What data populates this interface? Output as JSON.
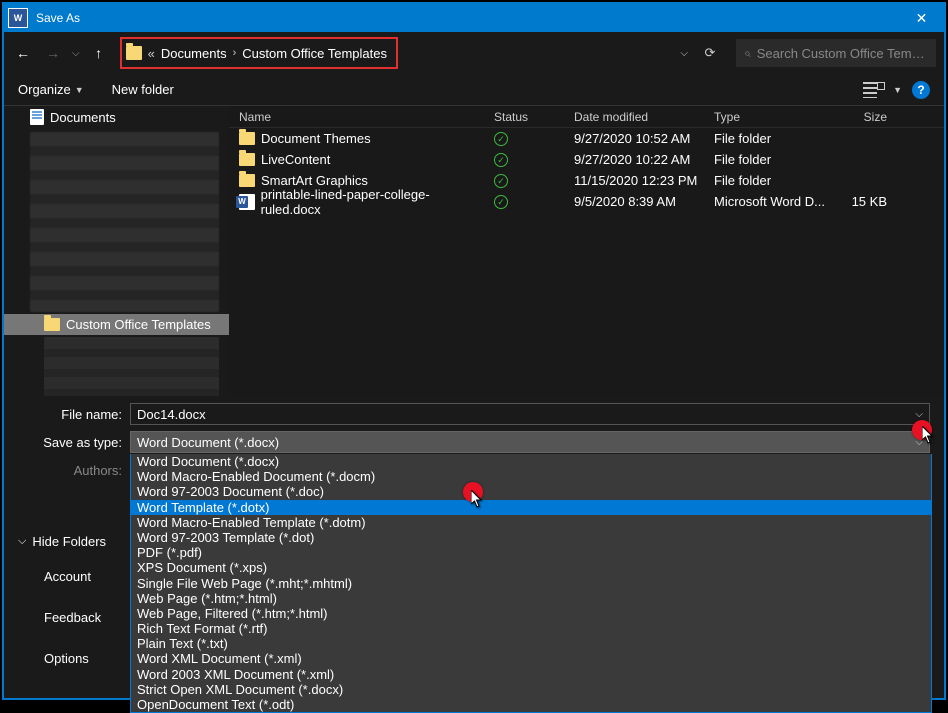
{
  "title": "Save As",
  "breadcrumb": {
    "seg1": "Documents",
    "seg2": "Custom Office Templates"
  },
  "search": {
    "placeholder": "Search Custom Office Templ..."
  },
  "toolbar": {
    "organize": "Organize",
    "newfolder": "New folder"
  },
  "nav": {
    "documents": "Documents",
    "selected": "Custom Office Templates"
  },
  "columns": {
    "name": "Name",
    "status": "Status",
    "date": "Date modified",
    "type": "Type",
    "size": "Size"
  },
  "files": [
    {
      "name": "Document Themes",
      "date": "9/27/2020 10:52 AM",
      "type": "File folder",
      "size": "",
      "kind": "folder"
    },
    {
      "name": "LiveContent",
      "date": "9/27/2020 10:22 AM",
      "type": "File folder",
      "size": "",
      "kind": "folder"
    },
    {
      "name": "SmartArt Graphics",
      "date": "11/15/2020 12:23 PM",
      "type": "File folder",
      "size": "",
      "kind": "folder"
    },
    {
      "name": "printable-lined-paper-college-ruled.docx",
      "date": "9/5/2020 8:39 AM",
      "type": "Microsoft Word D...",
      "size": "15 KB",
      "kind": "word"
    }
  ],
  "form": {
    "filename_label": "File name:",
    "filename_value": "Doc14.docx",
    "saveastype_label": "Save as type:",
    "saveastype_value": "Word Document (*.docx)",
    "authors_label": "Authors:"
  },
  "type_options": [
    "Word Document (*.docx)",
    "Word Macro-Enabled Document (*.docm)",
    "Word 97-2003 Document (*.doc)",
    "Word Template (*.dotx)",
    "Word Macro-Enabled Template (*.dotm)",
    "Word 97-2003 Template (*.dot)",
    "PDF (*.pdf)",
    "XPS Document (*.xps)",
    "Single File Web Page (*.mht;*.mhtml)",
    "Web Page (*.htm;*.html)",
    "Web Page, Filtered (*.htm;*.html)",
    "Rich Text Format (*.rtf)",
    "Plain Text (*.txt)",
    "Word XML Document (*.xml)",
    "Word 2003 XML Document (*.xml)",
    "Strict Open XML Document (*.docx)",
    "OpenDocument Text (*.odt)"
  ],
  "highlighted_option_index": 3,
  "hide_folders": "Hide Folders",
  "sidelinks": {
    "account": "Account",
    "feedback": "Feedback",
    "options": "Options"
  }
}
